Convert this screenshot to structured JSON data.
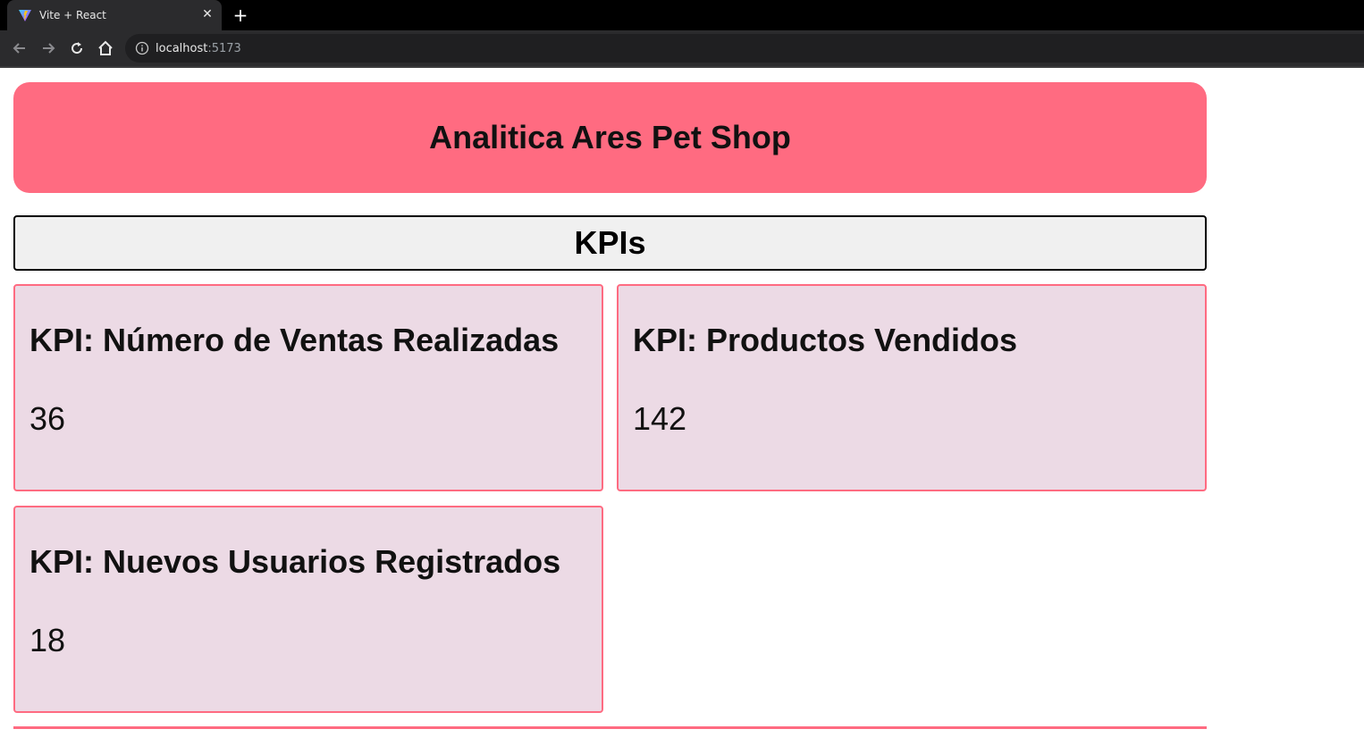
{
  "browser": {
    "tab_title": "Vite + React",
    "url_host": "localhost",
    "url_port": ":5173"
  },
  "header": {
    "title": "Analitica Ares Pet Shop"
  },
  "kpi_section": {
    "title": "KPIs",
    "cards": [
      {
        "label": "KPI: Número de Ventas Realizadas",
        "value": "36"
      },
      {
        "label": "KPI: Productos Vendidos",
        "value": "142"
      },
      {
        "label": "KPI: Nuevos Usuarios Registrados",
        "value": "18"
      }
    ]
  },
  "colors": {
    "accent": "#ff6b81",
    "card_bg": "#ecdae5",
    "section_bg": "#f0f0f0"
  },
  "icons": [
    "vite-icon",
    "close-icon",
    "plus-icon",
    "back-arrow-icon",
    "forward-arrow-icon",
    "reload-icon",
    "home-icon",
    "info-icon"
  ]
}
